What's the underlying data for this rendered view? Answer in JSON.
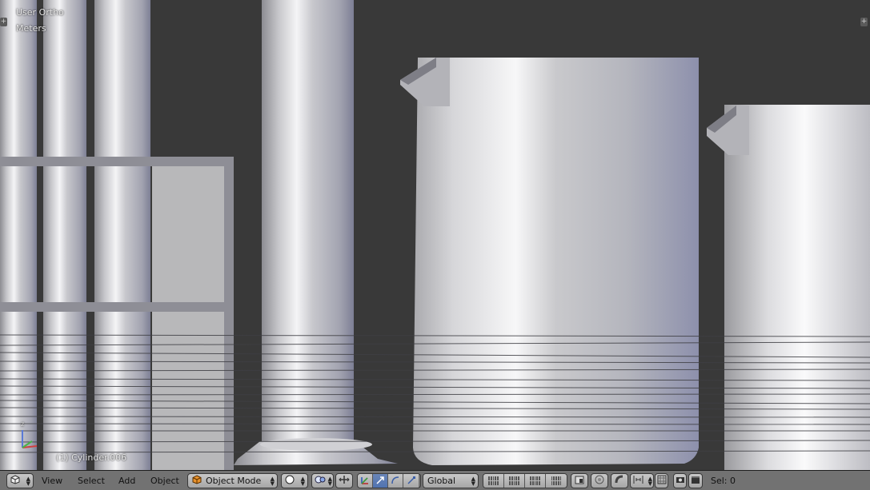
{
  "viewport": {
    "view_name": "User Ortho",
    "units": "Meters",
    "active_object": "(1) Cylinder.006",
    "axis_label": "z"
  },
  "header": {
    "menus": [
      "View",
      "Select",
      "Add",
      "Object"
    ],
    "mode": "Object Mode",
    "orientation": "Global",
    "selection": "Sel: 0"
  },
  "icons": {
    "editor_type": "3d-view-cube-icon",
    "mode": "object-cube-icon",
    "shading": "solid-sphere-icon",
    "pivot": "pivot-point-icon",
    "manipulator": "manipulator-axes-icon",
    "translate": "translate-arrow-icon",
    "rotate": "rotate-arc-icon",
    "scale": "scale-icon",
    "layers": "layer-grid-icon",
    "lock": "lock-camera-icon",
    "proportional": "proportional-edit-icon",
    "snap": "snap-magnet-icon",
    "snap_element": "snap-element-icon",
    "render_still": "render-camera-icon",
    "render_anim": "render-clapper-icon"
  },
  "colors": {
    "viewport_bg": "#393939",
    "header_bg": "#727272",
    "active_button": "#5073b0"
  }
}
